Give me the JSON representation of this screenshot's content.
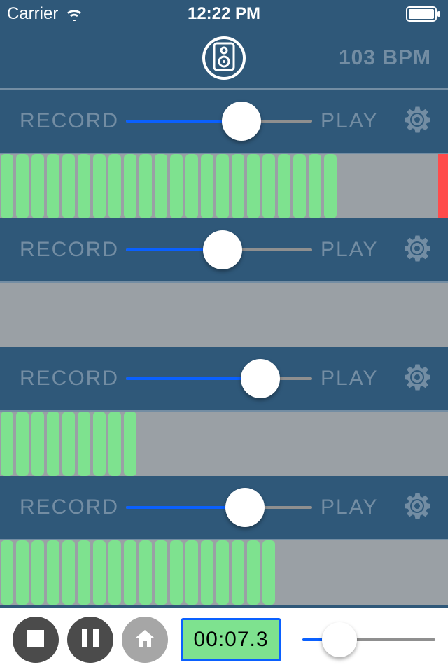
{
  "statusbar": {
    "carrier": "Carrier",
    "time": "12:22 PM"
  },
  "header": {
    "bpm_text": "103 BPM"
  },
  "tracks": [
    {
      "record_label": "RECORD",
      "play_label": "PLAY",
      "slider_value": 0.62,
      "meter_segments": 22,
      "meter_max": 32,
      "has_red_peak": true
    },
    {
      "record_label": "RECORD",
      "play_label": "PLAY",
      "slider_value": 0.52,
      "meter_segments": 0,
      "meter_max": 32,
      "has_red_peak": false
    },
    {
      "record_label": "RECORD",
      "play_label": "PLAY",
      "slider_value": 0.72,
      "meter_segments": 9,
      "meter_max": 32,
      "has_red_peak": false
    },
    {
      "record_label": "RECORD",
      "play_label": "PLAY",
      "slider_value": 0.64,
      "meter_segments": 18,
      "meter_max": 32,
      "has_red_peak": false
    }
  ],
  "toolbar": {
    "timer": "00:07.3",
    "master_slider": 0.28
  }
}
